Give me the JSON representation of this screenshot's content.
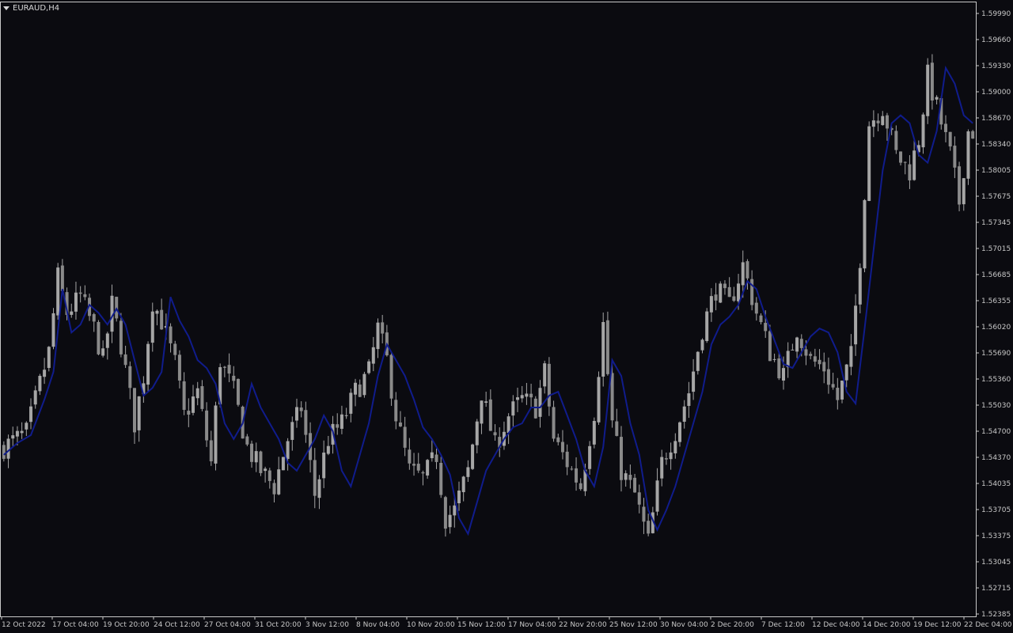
{
  "window": {
    "symbol": "EURAUD,H4"
  },
  "colors": {
    "background": "#0b0b10",
    "frame": "#c8c8c8",
    "candle": "#a6a6a6",
    "indicator": "#101c8c",
    "text": "#c8c8c8"
  },
  "chart_data": {
    "type": "candlestick",
    "symbol": "EURAUD",
    "timeframe": "H4",
    "price_labels": [
      "1.59990",
      "1.59660",
      "1.59330",
      "1.59000",
      "1.58670",
      "1.58340",
      "1.58005",
      "1.57675",
      "1.57345",
      "1.57015",
      "1.56685",
      "1.56355",
      "1.56020",
      "1.55690",
      "1.55360",
      "1.55030",
      "1.54700",
      "1.54370",
      "1.54035",
      "1.53705",
      "1.53375",
      "1.53045",
      "1.52715",
      "1.52385"
    ],
    "ylim": [
      1.52385,
      1.5999
    ],
    "time_labels": [
      "12 Oct 2022",
      "17 Oct 04:00",
      "19 Oct 20:00",
      "24 Oct 12:00",
      "27 Oct 04:00",
      "31 Oct 20:00",
      "3 Nov 12:00",
      "8 Nov 04:00",
      "10 Nov 20:00",
      "15 Nov 12:00",
      "17 Nov 04:00",
      "22 Nov 20:00",
      "25 Nov 12:00",
      "30 Nov 04:00",
      "2 Dec 20:00",
      "7 Dec 12:00",
      "12 Dec 04:00",
      "14 Dec 20:00",
      "19 Dec 12:00",
      "22 Dec 04:00"
    ],
    "close_anchors": [
      [
        0,
        1.545
      ],
      [
        5,
        1.5468
      ],
      [
        8,
        1.553
      ],
      [
        10,
        1.557
      ],
      [
        12,
        1.5665
      ],
      [
        14,
        1.562
      ],
      [
        17,
        1.564
      ],
      [
        20,
        1.56
      ],
      [
        22,
        1.556
      ],
      [
        24,
        1.563
      ],
      [
        26,
        1.558
      ],
      [
        29,
        1.548
      ],
      [
        31,
        1.554
      ],
      [
        33,
        1.5635
      ],
      [
        35,
        1.561
      ],
      [
        38,
        1.5555
      ],
      [
        40,
        1.549
      ],
      [
        43,
        1.552
      ],
      [
        46,
        1.543
      ],
      [
        48,
        1.556
      ],
      [
        51,
        1.552
      ],
      [
        54,
        1.545
      ],
      [
        57,
        1.542
      ],
      [
        60,
        1.54
      ],
      [
        63,
        1.546
      ],
      [
        66,
        1.55
      ],
      [
        69,
        1.539
      ],
      [
        72,
        1.546
      ],
      [
        75,
        1.548
      ],
      [
        78,
        1.552
      ],
      [
        81,
        1.5545
      ],
      [
        83,
        1.56
      ],
      [
        85,
        1.556
      ],
      [
        87,
        1.549
      ],
      [
        90,
        1.542
      ],
      [
        93,
        1.541
      ],
      [
        96,
        1.544
      ],
      [
        98,
        1.536
      ],
      [
        100,
        1.537
      ],
      [
        103,
        1.542
      ],
      [
        106,
        1.552
      ],
      [
        109,
        1.545
      ],
      [
        112,
        1.549
      ],
      [
        115,
        1.551
      ],
      [
        118,
        1.55
      ],
      [
        120,
        1.5545
      ],
      [
        122,
        1.546
      ],
      [
        125,
        1.543
      ],
      [
        128,
        1.54
      ],
      [
        131,
        1.5495
      ],
      [
        133,
        1.5605
      ],
      [
        135,
        1.548
      ],
      [
        137,
        1.542
      ],
      [
        140,
        1.539
      ],
      [
        143,
        1.533
      ],
      [
        146,
        1.543
      ],
      [
        149,
        1.547
      ],
      [
        152,
        1.552
      ],
      [
        155,
        1.56
      ],
      [
        158,
        1.565
      ],
      [
        161,
        1.563
      ],
      [
        164,
        1.568
      ],
      [
        167,
        1.562
      ],
      [
        170,
        1.557
      ],
      [
        173,
        1.554
      ],
      [
        176,
        1.56
      ],
      [
        179,
        1.556
      ],
      [
        182,
        1.555
      ],
      [
        185,
        1.551
      ],
      [
        188,
        1.5565
      ],
      [
        190,
        1.569
      ],
      [
        192,
        1.586
      ],
      [
        195,
        1.588
      ],
      [
        198,
        1.582
      ],
      [
        201,
        1.58
      ],
      [
        203,
        1.584
      ],
      [
        205,
        1.592
      ],
      [
        207,
        1.588
      ],
      [
        210,
        1.582
      ],
      [
        212,
        1.576
      ],
      [
        214,
        1.585
      ]
    ],
    "ma_anchors": [
      [
        0,
        1.544
      ],
      [
        3,
        1.5455
      ],
      [
        6,
        1.5465
      ],
      [
        9,
        1.551
      ],
      [
        11,
        1.5545
      ],
      [
        13,
        1.565
      ],
      [
        15,
        1.5595
      ],
      [
        17,
        1.5605
      ],
      [
        19,
        1.563
      ],
      [
        21,
        1.562
      ],
      [
        23,
        1.5605
      ],
      [
        25,
        1.5625
      ],
      [
        27,
        1.5605
      ],
      [
        29,
        1.556
      ],
      [
        31,
        1.5515
      ],
      [
        33,
        1.5525
      ],
      [
        35,
        1.5545
      ],
      [
        37,
        1.564
      ],
      [
        39,
        1.561
      ],
      [
        41,
        1.559
      ],
      [
        43,
        1.556
      ],
      [
        45,
        1.555
      ],
      [
        47,
        1.553
      ],
      [
        49,
        1.548
      ],
      [
        51,
        1.546
      ],
      [
        53,
        1.548
      ],
      [
        55,
        1.553
      ],
      [
        57,
        1.55
      ],
      [
        59,
        1.548
      ],
      [
        61,
        1.546
      ],
      [
        63,
        1.543
      ],
      [
        65,
        1.542
      ],
      [
        67,
        1.544
      ],
      [
        69,
        1.546
      ],
      [
        71,
        1.549
      ],
      [
        73,
        1.547
      ],
      [
        75,
        1.542
      ],
      [
        77,
        1.54
      ],
      [
        79,
        1.544
      ],
      [
        81,
        1.548
      ],
      [
        83,
        1.554
      ],
      [
        85,
        1.558
      ],
      [
        87,
        1.556
      ],
      [
        89,
        1.554
      ],
      [
        91,
        1.551
      ],
      [
        93,
        1.5475
      ],
      [
        95,
        1.546
      ],
      [
        97,
        1.544
      ],
      [
        99,
        1.5415
      ],
      [
        101,
        1.536
      ],
      [
        103,
        1.534
      ],
      [
        105,
        1.538
      ],
      [
        107,
        1.542
      ],
      [
        109,
        1.544
      ],
      [
        111,
        1.546
      ],
      [
        113,
        1.5475
      ],
      [
        115,
        1.548
      ],
      [
        117,
        1.55
      ],
      [
        119,
        1.55
      ],
      [
        121,
        1.5515
      ],
      [
        123,
        1.552
      ],
      [
        125,
        1.549
      ],
      [
        127,
        1.546
      ],
      [
        129,
        1.542
      ],
      [
        131,
        1.54
      ],
      [
        133,
        1.545
      ],
      [
        135,
        1.556
      ],
      [
        137,
        1.554
      ],
      [
        139,
        1.548
      ],
      [
        141,
        1.544
      ],
      [
        143,
        1.537
      ],
      [
        145,
        1.5345
      ],
      [
        147,
        1.537
      ],
      [
        149,
        1.54
      ],
      [
        151,
        1.544
      ],
      [
        153,
        1.548
      ],
      [
        155,
        1.552
      ],
      [
        157,
        1.558
      ],
      [
        159,
        1.5605
      ],
      [
        161,
        1.5615
      ],
      [
        163,
        1.563
      ],
      [
        165,
        1.566
      ],
      [
        167,
        1.565
      ],
      [
        169,
        1.5615
      ],
      [
        171,
        1.5585
      ],
      [
        173,
        1.5555
      ],
      [
        175,
        1.555
      ],
      [
        177,
        1.557
      ],
      [
        179,
        1.559
      ],
      [
        181,
        1.56
      ],
      [
        183,
        1.5595
      ],
      [
        185,
        1.557
      ],
      [
        187,
        1.552
      ],
      [
        189,
        1.5505
      ],
      [
        191,
        1.56
      ],
      [
        193,
        1.57
      ],
      [
        195,
        1.58
      ],
      [
        197,
        1.586
      ],
      [
        199,
        1.587
      ],
      [
        201,
        1.586
      ],
      [
        203,
        1.582
      ],
      [
        205,
        1.581
      ],
      [
        207,
        1.585
      ],
      [
        209,
        1.593
      ],
      [
        211,
        1.591
      ],
      [
        213,
        1.587
      ],
      [
        215,
        1.586
      ]
    ],
    "candle_count": 216,
    "grid": false
  }
}
